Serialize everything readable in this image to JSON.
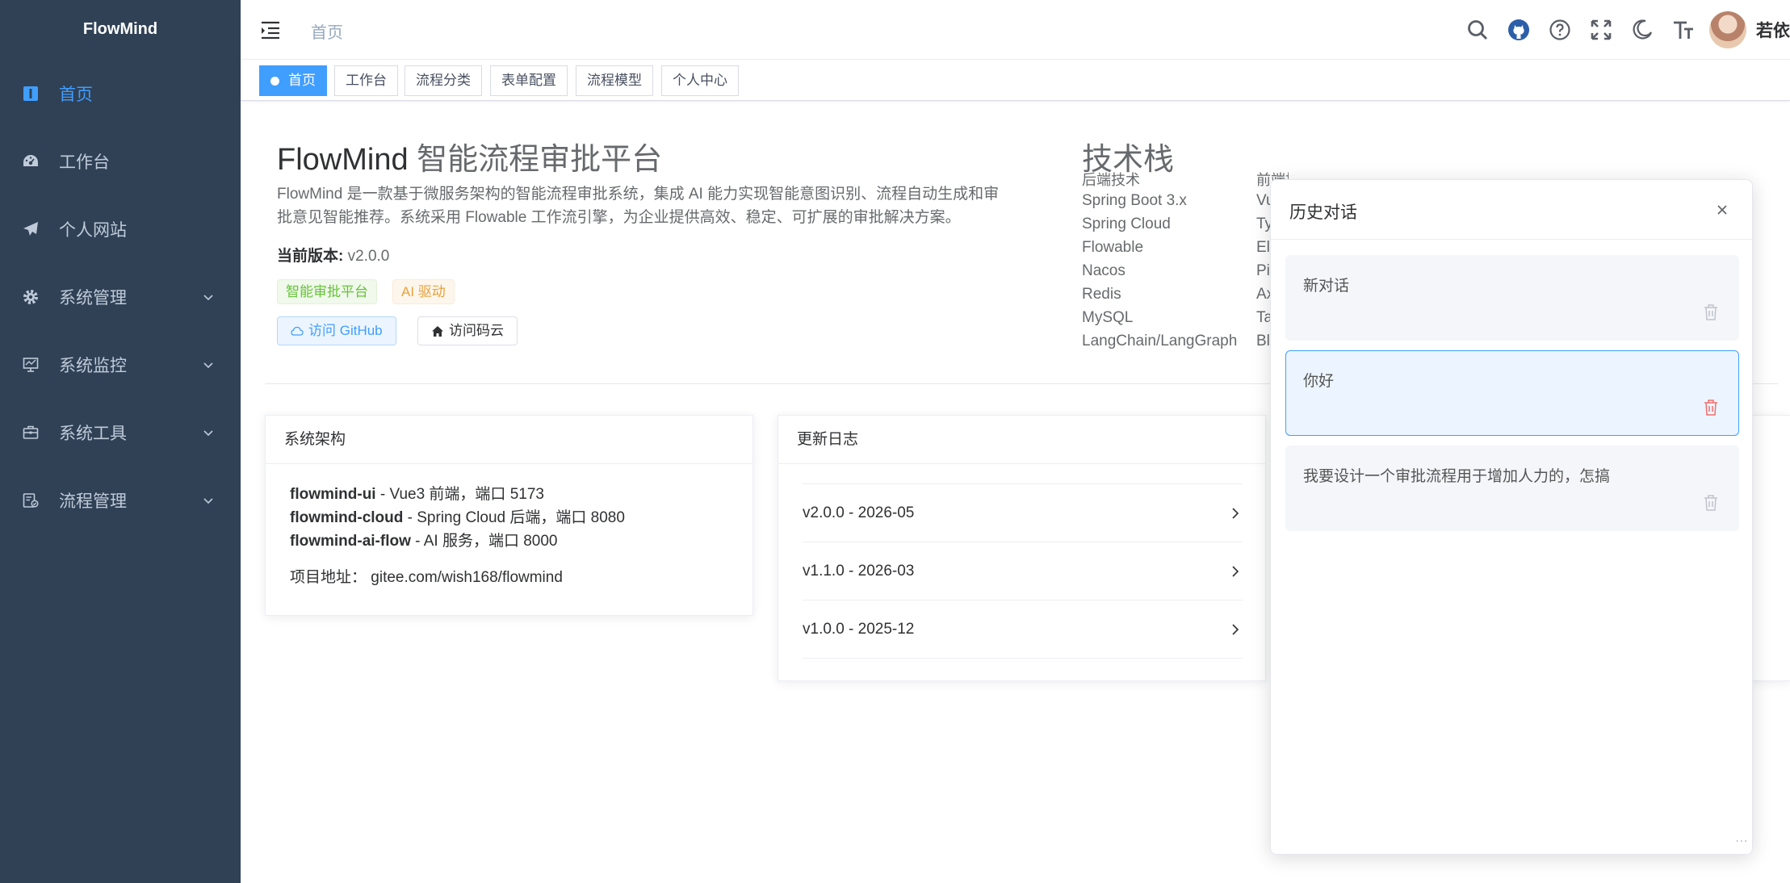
{
  "sidebar": {
    "logo": "FlowMind",
    "items": [
      {
        "label": "首页",
        "icon": "guide-icon",
        "active": true
      },
      {
        "label": "工作台",
        "icon": "dashboard-icon"
      },
      {
        "label": "个人网站",
        "icon": "send-icon"
      },
      {
        "label": "系统管理",
        "icon": "system-icon",
        "expandable": true
      },
      {
        "label": "系统监控",
        "icon": "monitor-icon",
        "expandable": true
      },
      {
        "label": "系统工具",
        "icon": "tool-icon",
        "expandable": true
      },
      {
        "label": "流程管理",
        "icon": "flow-icon",
        "expandable": true
      }
    ]
  },
  "navbar": {
    "breadcrumb": "首页",
    "username": "若依",
    "icons": [
      "search-icon",
      "github-icon",
      "question-icon",
      "fullscreen-icon",
      "moon-icon",
      "font-size-icon"
    ]
  },
  "tags": [
    "首页",
    "工作台",
    "流程分类",
    "表单配置",
    "流程模型",
    "个人中心"
  ],
  "intro": {
    "title": "FlowMind",
    "subtitle": "智能流程审批平台",
    "description": "FlowMind 是一款基于微服务架构的智能流程审批系统，集成 AI 能力实现智能意图识别、流程自动生成和审批意见智能推荐。系统采用 Flowable 工作流引擎，为企业提供高效、稳定、可扩展的审批解决方案。",
    "version_label": "当前版本:",
    "version": "v2.0.0",
    "badges": [
      "智能审批平台",
      "AI 驱动"
    ],
    "github_button": "访问 GitHub",
    "gitee_button": "访问码云"
  },
  "tech": {
    "title": "技术栈",
    "backend_head": "后端技术",
    "frontend_head": "前端技术",
    "backend": [
      "Spring Boot 3.x",
      "Spring Cloud",
      "Flowable",
      "Nacos",
      "Redis",
      "MySQL",
      "LangChain/LangGraph"
    ],
    "frontend_visible": [
      "Vu",
      "Ty",
      "El",
      "Pi",
      "Ax",
      "Ta",
      "Bl"
    ]
  },
  "architecture": {
    "title": "系统架构",
    "items": [
      {
        "name": "flowmind-ui",
        "desc": " - Vue3 前端，端口 5173"
      },
      {
        "name": "flowmind-cloud",
        "desc": " - Spring Cloud 后端，端口 8080"
      },
      {
        "name": "flowmind-ai-flow",
        "desc": " - AI 服务，端口 8000"
      }
    ],
    "address_label": "项目地址：",
    "address": "gitee.com/wish168/flowmind"
  },
  "changelog": {
    "title": "更新日志",
    "items": [
      "v2.0.0 - 2026-05",
      "v1.1.0 - 2026-03",
      "v1.0.0 - 2025-12"
    ]
  },
  "history": {
    "title": "历史对话",
    "items": [
      {
        "text": "新对话",
        "active": false
      },
      {
        "text": "你好",
        "active": true
      },
      {
        "text": "我要设计一个审批流程用于增加人力的，怎搞",
        "active": false
      }
    ],
    "colors": {
      "active_border": "#409eff",
      "delete_active": "#f56c6c",
      "delete_idle": "#c0c4cc"
    }
  }
}
